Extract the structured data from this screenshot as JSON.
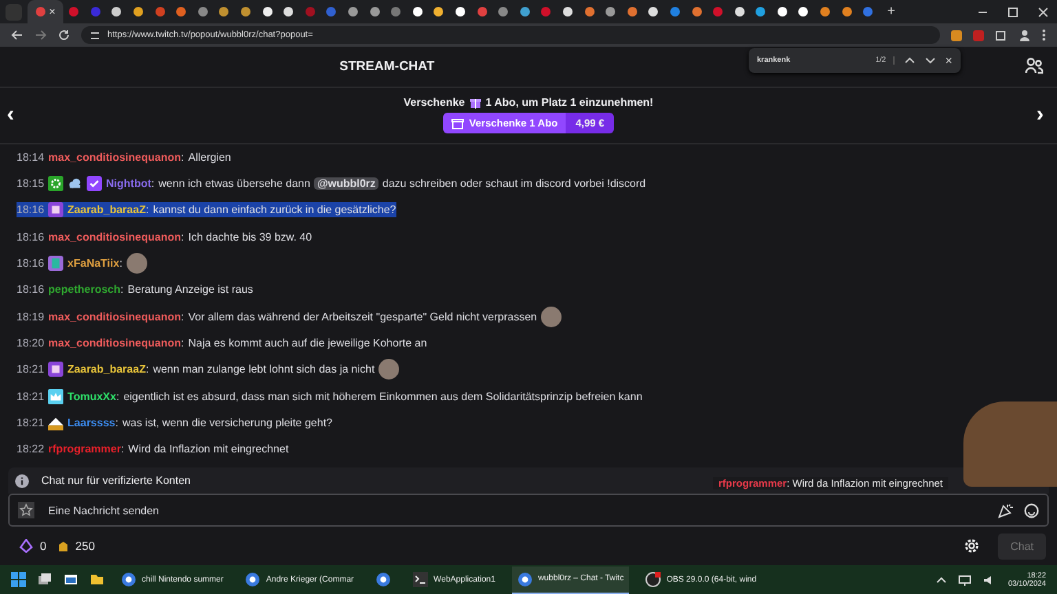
{
  "browser": {
    "tabs": [
      {
        "color": "#e04040",
        "selected": true,
        "close": "×"
      },
      {
        "color": "#d0102a",
        "selected": false
      },
      {
        "color": "#3a2ad8",
        "selected": false
      },
      {
        "color": "#cccccc",
        "selected": false
      },
      {
        "color": "#e0a020",
        "selected": false
      },
      {
        "color": "#d04020",
        "selected": false
      },
      {
        "color": "#e06020",
        "selected": false
      },
      {
        "color": "#888888",
        "selected": false
      },
      {
        "color": "#c09030",
        "selected": false
      },
      {
        "color": "#c09030",
        "selected": false
      },
      {
        "color": "#eeeeee",
        "selected": false
      },
      {
        "color": "#dddddd",
        "selected": false
      },
      {
        "color": "#a01020",
        "selected": false
      },
      {
        "color": "#3060d0",
        "selected": false
      },
      {
        "color": "#999999",
        "selected": false
      },
      {
        "color": "#999999",
        "selected": false
      },
      {
        "color": "#777777",
        "selected": false
      },
      {
        "color": "#ffffff",
        "selected": false
      },
      {
        "color": "#f0b030",
        "selected": false
      },
      {
        "color": "#ffffff",
        "selected": false
      },
      {
        "color": "#e04040",
        "selected": false
      },
      {
        "color": "#888888",
        "selected": false
      },
      {
        "color": "#40a0d0",
        "selected": false
      },
      {
        "color": "#d0102a",
        "selected": false
      },
      {
        "color": "#dddddd",
        "selected": false
      },
      {
        "color": "#e07030",
        "selected": false
      },
      {
        "color": "#999999",
        "selected": false
      },
      {
        "color": "#e07030",
        "selected": false
      },
      {
        "color": "#dddddd",
        "selected": false
      },
      {
        "color": "#2080e0",
        "selected": false
      },
      {
        "color": "#e07030",
        "selected": false
      },
      {
        "color": "#d0102a",
        "selected": false
      },
      {
        "color": "#dddddd",
        "selected": false
      },
      {
        "color": "#20a0e0",
        "selected": false
      },
      {
        "color": "#ffffff",
        "selected": false
      },
      {
        "color": "#ffffff",
        "selected": false
      },
      {
        "color": "#e08020",
        "selected": false
      },
      {
        "color": "#e08020",
        "selected": false
      },
      {
        "color": "#3070e0",
        "selected": false
      }
    ],
    "new_tab": "+",
    "url": "https://www.twitch.tv/popout/wubbl0rz/chat?popout=",
    "find": {
      "query": "krankenk",
      "count": "1/2",
      "close": "×"
    }
  },
  "header": {
    "title": "STREAM-CHAT"
  },
  "banner": {
    "text_before": "Verschenke",
    "text_after": "1 Abo, um Platz 1 einzunehmen!",
    "button": "Verschenke 1 Abo",
    "price": "4,99 €",
    "prev": "‹",
    "next": "›"
  },
  "messages": [
    {
      "time": "18:14",
      "user": "max_conditiosinequanon",
      "sep": ":",
      "color": "#f05c5c",
      "parts": [
        {
          "kind": "text",
          "text": "Allergien"
        }
      ],
      "selected": false
    },
    {
      "time": "18:15",
      "badges": [
        {
          "kind": "gear"
        },
        {
          "kind": "cloud"
        },
        {
          "kind": "verified"
        }
      ],
      "user": "Nightbot",
      "sep": ":",
      "color": "#8a6cf0",
      "parts": [
        {
          "kind": "text",
          "text": "wenn ich etwas übersehe dann"
        },
        {
          "kind": "mention",
          "text": "@wubbl0rz"
        },
        {
          "kind": "text",
          "text": "dazu schreiben oder schaut im discord vorbei !discord"
        }
      ],
      "selected": false
    },
    {
      "time": "18:16",
      "badges": [
        {
          "kind": "sub"
        }
      ],
      "user": "Zaarab_baraaZ",
      "sep": ":",
      "color": "#e8c43a",
      "parts": [
        {
          "kind": "text",
          "text": "kannst du dann einfach zurück in die gesätzliche?"
        }
      ],
      "selected": true
    },
    {
      "time": "18:16",
      "user": "max_conditiosinequanon",
      "sep": ":",
      "color": "#f05c5c",
      "parts": [
        {
          "kind": "text",
          "text": "Ich dachte bis 39 bzw. 40"
        }
      ],
      "selected": false
    },
    {
      "time": "18:16",
      "badges": [
        {
          "kind": "tier"
        }
      ],
      "user": "xFaNaTiix",
      "sep": ":",
      "color": "#e0a040",
      "emote": true,
      "selected": false
    },
    {
      "time": "18:16",
      "user": "pepetherosch",
      "sep": ":",
      "color": "#2fa82f",
      "parts": [
        {
          "kind": "text",
          "text": "Beratung Anzeige ist raus"
        }
      ],
      "selected": false
    },
    {
      "time": "18:19",
      "user": "max_conditiosinequanon",
      "sep": ":",
      "color": "#f05c5c",
      "parts": [
        {
          "kind": "text",
          "text": "Vor allem das während der Arbeitszeit \"gesparte\" Geld nicht verprassen"
        }
      ],
      "emote": true,
      "selected": false
    },
    {
      "time": "18:20",
      "user": "max_conditiosinequanon",
      "sep": ":",
      "color": "#f05c5c",
      "parts": [
        {
          "kind": "text",
          "text": "Naja es kommt auch auf die jeweilige Kohorte an"
        }
      ],
      "selected": false
    },
    {
      "time": "18:21",
      "badges": [
        {
          "kind": "sub"
        }
      ],
      "user": "Zaarab_baraaZ",
      "sep": ":",
      "color": "#e8c43a",
      "parts": [
        {
          "kind": "text",
          "text": "wenn man zulange lebt lohnt sich das ja nicht"
        }
      ],
      "emote": true,
      "selected": false
    },
    {
      "time": "18:21",
      "badges": [
        {
          "kind": "crown"
        }
      ],
      "user": "TomuxXx",
      "sep": ":",
      "color": "#2ee06a",
      "parts": [
        {
          "kind": "text",
          "text": "eigentlich ist es absurd, dass man sich mit höherem Einkommen aus dem Solidaritätsprinzip befreien kann"
        }
      ],
      "selected": false
    },
    {
      "time": "18:21",
      "badges": [
        {
          "kind": "year"
        }
      ],
      "user": "Laarssss",
      "sep": ":",
      "color": "#3c8cf0",
      "parts": [
        {
          "kind": "text",
          "text": "was ist, wenn die versicherung pleite geht?"
        }
      ],
      "selected": false
    },
    {
      "time": "18:22",
      "user": "rfprogrammer",
      "sep": ":",
      "color": "#e8202a",
      "parts": [
        {
          "kind": "text",
          "text": "Wird da Inflazion mit eingrechnet"
        }
      ],
      "selected": false
    }
  ],
  "overlay": {
    "user": "rfprogrammer",
    "sep": ":",
    "message": "Wird da Inflazion mit eingrechnet"
  },
  "notice": "Chat nur für verifizierte Konten",
  "input": {
    "placeholder": "Eine Nachricht senden"
  },
  "footer": {
    "bits": "0",
    "points": "250",
    "chat_button": "Chat"
  },
  "taskbar": {
    "apps": [
      {
        "label": "chill Nintendo summer",
        "kind": "chrome",
        "selected": false
      },
      {
        "label": "Andre Krieger (Commar",
        "kind": "chrome",
        "selected": false
      },
      {
        "kind": "chrome",
        "selected": false
      },
      {
        "label": "WebApplication1",
        "kind": "terminal",
        "selected": false
      },
      {
        "label": "wubbl0rz – Chat - Twitc",
        "kind": "chrome",
        "selected": true
      },
      {
        "label": "OBS 29.0.0 (64-bit, wind",
        "kind": "obs",
        "selected": false
      }
    ],
    "time": "18:22",
    "date": "03/10/2024"
  }
}
